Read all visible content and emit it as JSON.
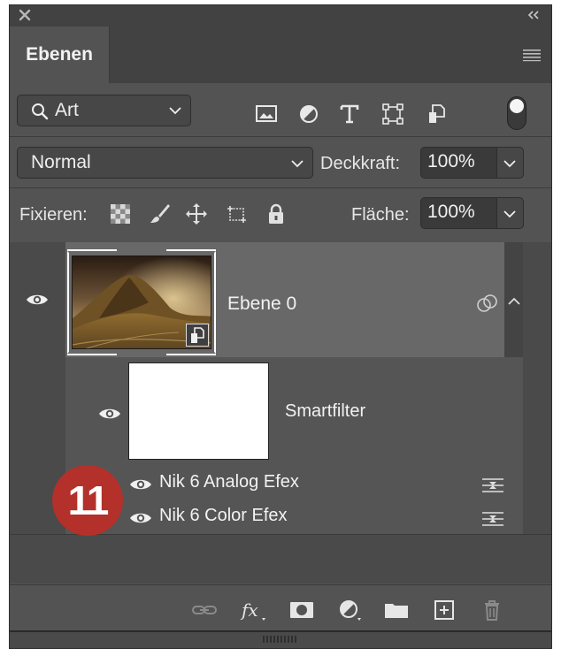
{
  "panel": {
    "tab_label": "Ebenen"
  },
  "filter": {
    "kind_label": "Art",
    "icons": [
      "image-filter-icon",
      "adjustment-filter-icon",
      "type-filter-icon",
      "shape-filter-icon",
      "smartobject-filter-icon"
    ]
  },
  "blend": {
    "mode": "Normal",
    "opacity_label": "Deckkraft:",
    "opacity_value": "100%"
  },
  "lock": {
    "label": "Fixieren:",
    "fill_label": "Fläche:",
    "fill_value": "100%"
  },
  "layers": [
    {
      "name": "Ebene 0",
      "selected": true
    }
  ],
  "smart_filters": {
    "label": "Smartfilter",
    "filters": [
      {
        "name": "Nik 6 Analog Efex"
      },
      {
        "name": "Nik 6 Color Efex"
      }
    ]
  },
  "callout": {
    "number": "11",
    "color": "#b4302a"
  },
  "colors": {
    "panel_bg": "#535353",
    "selected_row": "#686868",
    "titlebar": "#424242"
  }
}
